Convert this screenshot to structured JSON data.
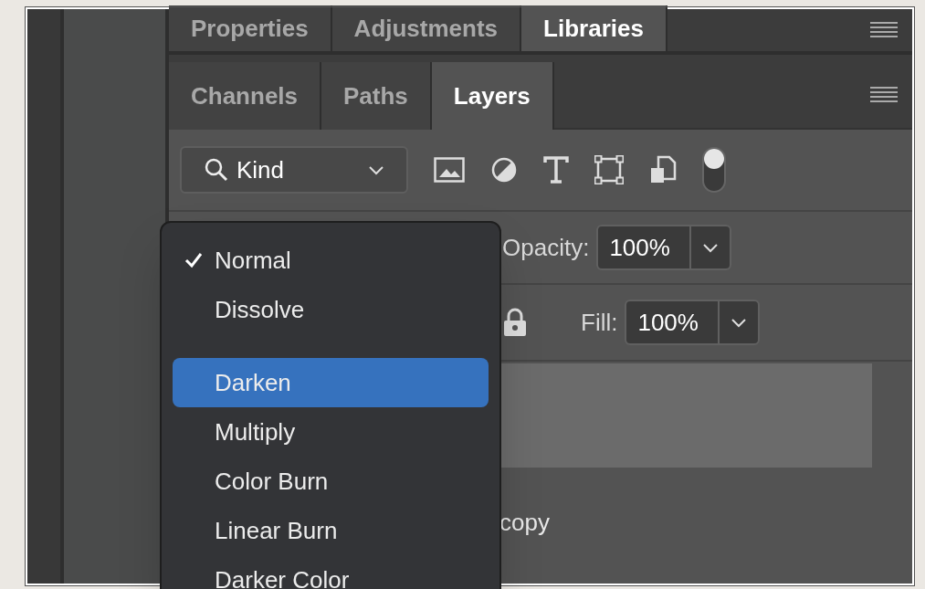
{
  "top_tabs": [
    {
      "label": "Properties",
      "selected": false
    },
    {
      "label": "Adjustments",
      "selected": false
    },
    {
      "label": "Libraries",
      "selected": true
    }
  ],
  "panel_tabs": [
    {
      "label": "Channels",
      "selected": false
    },
    {
      "label": "Paths",
      "selected": false
    },
    {
      "label": "Layers",
      "selected": true
    }
  ],
  "filter": {
    "value": "Kind",
    "toggle_on": true
  },
  "opacity": {
    "label": "Opacity:",
    "value": "100%"
  },
  "fill": {
    "label": "Fill:",
    "value": "100%"
  },
  "layers": [
    {
      "selected": true
    },
    {
      "name": "copy",
      "selected": false
    }
  ],
  "blend_menu": [
    {
      "kind": "item",
      "label": "Normal",
      "checked": true,
      "selected": false
    },
    {
      "kind": "item",
      "label": "Dissolve",
      "checked": false,
      "selected": false
    },
    {
      "kind": "separator"
    },
    {
      "kind": "item",
      "label": "Darken",
      "checked": false,
      "selected": true
    },
    {
      "kind": "item",
      "label": "Multiply",
      "checked": false,
      "selected": false
    },
    {
      "kind": "item",
      "label": "Color Burn",
      "checked": false,
      "selected": false
    },
    {
      "kind": "item",
      "label": "Linear Burn",
      "checked": false,
      "selected": false
    },
    {
      "kind": "item",
      "label": "Darker Color",
      "checked": false,
      "selected": false
    }
  ]
}
